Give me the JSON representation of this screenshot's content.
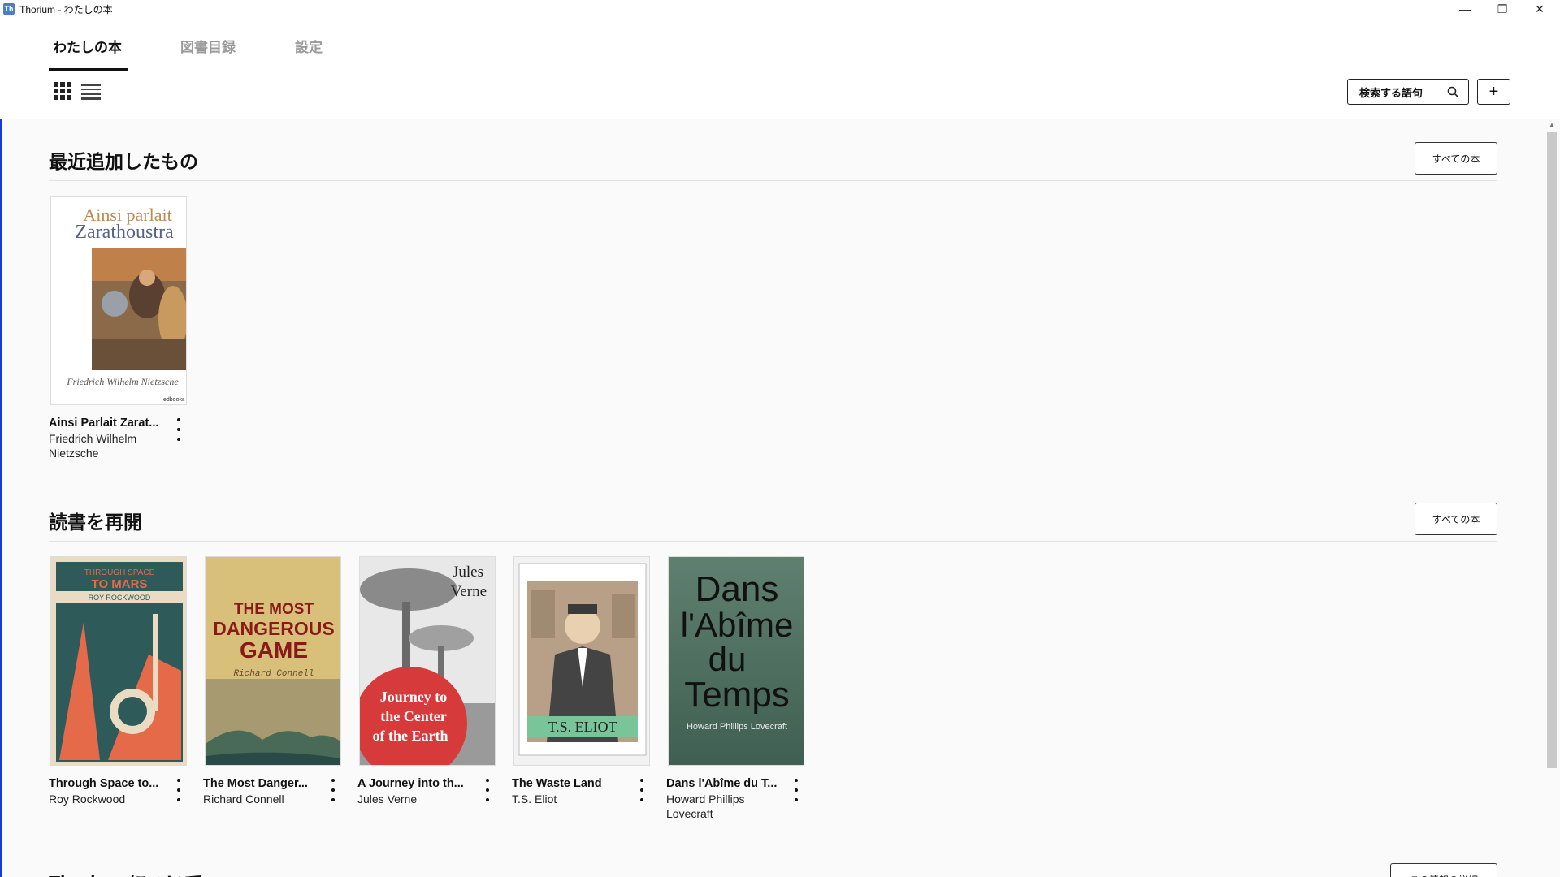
{
  "window": {
    "app_icon_text": "Th",
    "title": "Thorium - わたしの本",
    "minimize": "—",
    "restore": "❐",
    "close": "✕"
  },
  "nav": {
    "tabs": [
      {
        "label": "わたしの本",
        "active": true
      },
      {
        "label": "図書目録",
        "active": false
      },
      {
        "label": "設定",
        "active": false
      }
    ]
  },
  "toolbar": {
    "search_label": "検索する語句",
    "add_label": "+"
  },
  "sections": {
    "recent": {
      "title": "最近追加したもの",
      "all_button": "すべての本",
      "books": [
        {
          "title": "Ainsi Parlait Zarat...",
          "author": "Friedrich Wilhelm Nietzsche",
          "cover_title": "Ainsi parlait Zarathoustra",
          "cover_author": "Friedrich Wilhelm Nietzsche",
          "cover_publisher": "edbooks"
        }
      ]
    },
    "resume": {
      "title": "読書を再開",
      "all_button": "すべての本",
      "books": [
        {
          "title": "Through Space to...",
          "author": "Roy Rockwood",
          "cover_lines": [
            "THROUGH SPACE",
            "TO MARS",
            "ROY ROCKWOOD"
          ]
        },
        {
          "title": "The Most Danger...",
          "author": "Richard Connell",
          "cover_lines": [
            "THE MOST",
            "DANGEROUS",
            "GAME",
            "Richard Connell"
          ]
        },
        {
          "title": "A Journey into th...",
          "author": "Jules Verne",
          "cover_lines": [
            "Jules",
            "Verne",
            "Journey to",
            "the Center",
            "of the Earth"
          ]
        },
        {
          "title": "The Waste Land",
          "author": "T.S. Eliot",
          "cover_lines": [
            "T.S. ELIOT"
          ]
        },
        {
          "title": "Dans l'Abîme du T...",
          "author": "Howard Phillips Lovecraft",
          "cover_lines": [
            "Dans",
            "l'Abîme",
            "du",
            "Temps",
            "Howard Phillips Lovecraft"
          ]
        }
      ]
    },
    "about": {
      "title": "Thorium について",
      "button": "この情報の詳細"
    }
  },
  "colors": {
    "accent_line": "#1a3ad6",
    "text": "#111111",
    "inactive_tab": "#9a9a9a"
  }
}
